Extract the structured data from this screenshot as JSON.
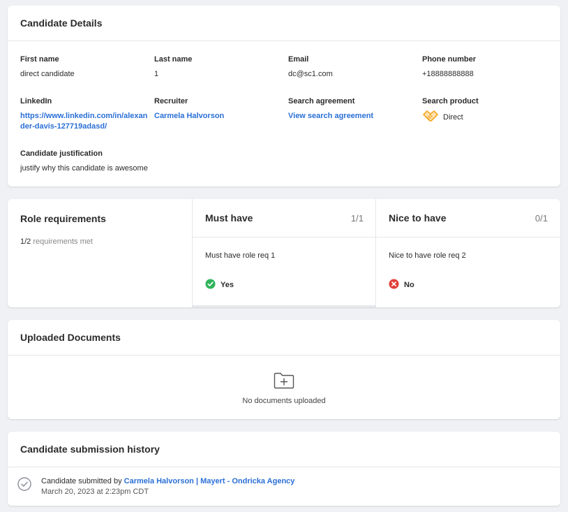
{
  "candidate_details": {
    "title": "Candidate Details",
    "first_name": {
      "label": "First name",
      "value": "direct candidate"
    },
    "last_name": {
      "label": "Last name",
      "value": "1"
    },
    "email": {
      "label": "Email",
      "value": "dc@sc1.com"
    },
    "phone": {
      "label": "Phone number",
      "value": "+18888888888"
    },
    "linkedin": {
      "label": "LinkedIn",
      "value_line1": "https://www.linkedin.com/in/alexan",
      "value_line2": "der-davis-127719adasd/"
    },
    "recruiter": {
      "label": "Recruiter",
      "value": "Carmela Halvorson"
    },
    "search_agreement": {
      "label": "Search agreement",
      "value": "View search agreement"
    },
    "search_product": {
      "label": "Search product",
      "value": "Direct",
      "icon": "handshake-icon"
    },
    "justification": {
      "label": "Candidate justification",
      "value": "justify why this candidate is awesome"
    }
  },
  "role_requirements": {
    "title": "Role requirements",
    "met_count": "1/2",
    "met_text": "requirements met",
    "must_have": {
      "title": "Must have",
      "count": "1/1",
      "item": "Must have role req 1",
      "answer": "Yes",
      "status_color": "#2fb45a"
    },
    "nice_to_have": {
      "title": "Nice to have",
      "count": "0/1",
      "item": "Nice to have role req 2",
      "answer": "No",
      "status_color": "#e0403a"
    }
  },
  "documents": {
    "title": "Uploaded Documents",
    "empty_text": "No documents uploaded",
    "icon": "folder-plus-icon"
  },
  "history": {
    "title": "Candidate submission history",
    "entry_prefix": "Candidate submitted by",
    "entry_link": "Carmela Halvorson | Mayert - Ondricka Agency",
    "entry_date": "March 20, 2023 at 2:23pm CDT",
    "icon": "check-circle-icon"
  },
  "colors": {
    "link": "#2a6fd6",
    "background": "#f0f1f4",
    "accent_orange": "#f5a623"
  }
}
